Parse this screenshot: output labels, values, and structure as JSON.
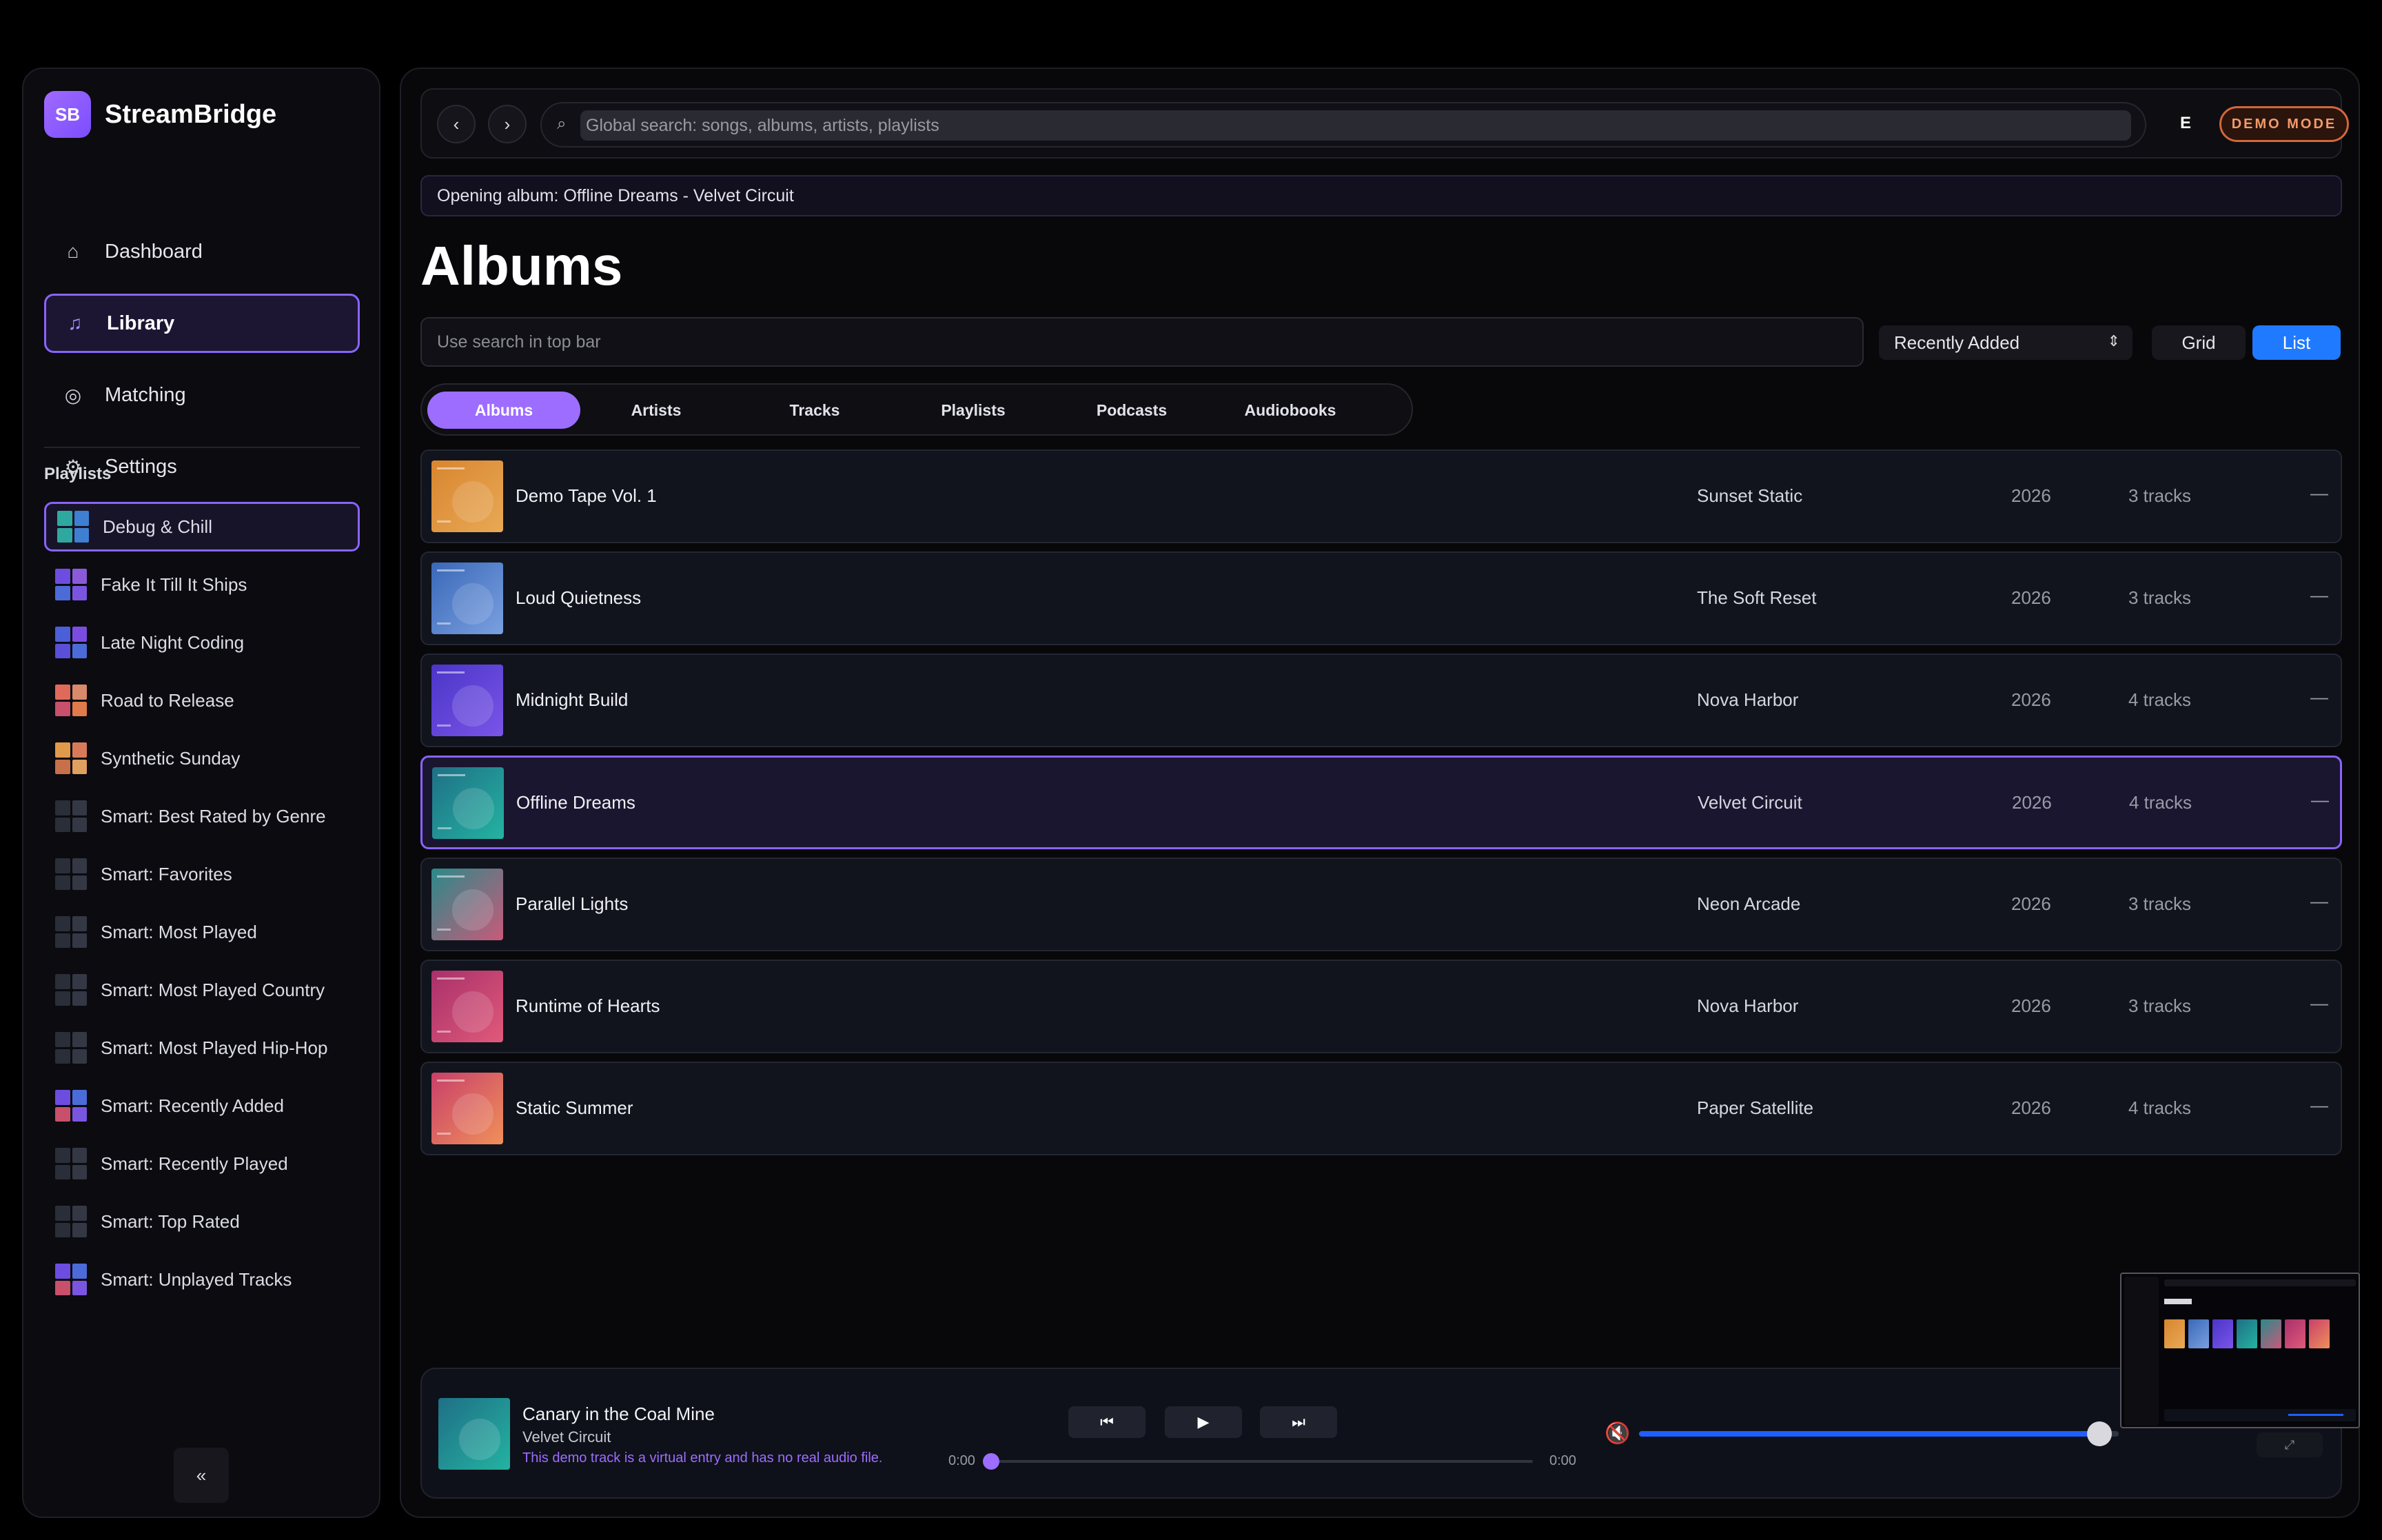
{
  "app": {
    "logo_text": "SB",
    "name": "StreamBridge"
  },
  "nav": {
    "items": [
      {
        "label": "Dashboard",
        "icon": "home-icon",
        "glyph": "⌂",
        "active": false
      },
      {
        "label": "Library",
        "icon": "music-note-icon",
        "glyph": "♫",
        "active": true
      },
      {
        "label": "Matching",
        "icon": "target-icon",
        "glyph": "◎",
        "active": false
      },
      {
        "label": "Settings",
        "icon": "gear-icon",
        "glyph": "⚙",
        "active": false
      }
    ]
  },
  "playlists": {
    "heading": "Playlists",
    "items": [
      {
        "label": "Debug & Chill",
        "active": true,
        "colors": [
          "#2fa9a0",
          "#3e7fd1",
          "#2fa9a0",
          "#3e7fd1"
        ]
      },
      {
        "label": "Fake It Till It Ships",
        "active": false,
        "colors": [
          "#6d4de0",
          "#8a5ad8",
          "#4b6bd8",
          "#7a55e0"
        ]
      },
      {
        "label": "Late Night Coding",
        "active": false,
        "colors": [
          "#4b5fd8",
          "#7a4de0",
          "#5a4fd8",
          "#4b6bd8"
        ]
      },
      {
        "label": "Road to Release",
        "active": false,
        "colors": [
          "#e06a5a",
          "#d88a6a",
          "#c8506a",
          "#e07a4a"
        ]
      },
      {
        "label": "Synthetic Sunday",
        "active": false,
        "colors": [
          "#e09a4a",
          "#d87a5a",
          "#c8704a",
          "#e0a060"
        ]
      },
      {
        "label": "Smart: Best Rated by Genre",
        "active": false,
        "colors": [
          "#2a2e38",
          "#343844",
          "#2a2e38",
          "#343844"
        ]
      },
      {
        "label": "Smart: Favorites",
        "active": false,
        "colors": [
          "#2a2e38",
          "#343844",
          "#2a2e38",
          "#343844"
        ]
      },
      {
        "label": "Smart: Most Played",
        "active": false,
        "colors": [
          "#2a2e38",
          "#343844",
          "#2a2e38",
          "#343844"
        ]
      },
      {
        "label": "Smart: Most Played Country",
        "active": false,
        "colors": [
          "#2a2e38",
          "#343844",
          "#2a2e38",
          "#343844"
        ]
      },
      {
        "label": "Smart: Most Played Hip-Hop",
        "active": false,
        "colors": [
          "#2a2e38",
          "#343844",
          "#2a2e38",
          "#343844"
        ]
      },
      {
        "label": "Smart: Recently Added",
        "active": false,
        "colors": [
          "#6d4de0",
          "#4b6bd8",
          "#c8506a",
          "#7a55e0"
        ]
      },
      {
        "label": "Smart: Recently Played",
        "active": false,
        "colors": [
          "#2a2e38",
          "#343844",
          "#2a2e38",
          "#343844"
        ]
      },
      {
        "label": "Smart: Top Rated",
        "active": false,
        "colors": [
          "#2a2e38",
          "#343844",
          "#2a2e38",
          "#343844"
        ]
      },
      {
        "label": "Smart: Unplayed Tracks",
        "active": false,
        "colors": [
          "#6d4de0",
          "#4b6bd8",
          "#c8506a",
          "#7a55e0"
        ]
      }
    ]
  },
  "sidebar": {
    "collapse_label": "«"
  },
  "topbar": {
    "back_label": "‹",
    "forward_label": "›",
    "search_icon": "⌕",
    "search_placeholder": "Global search: songs, albums, artists, playlists",
    "avatar_letter": "E",
    "demo_badge": "DEMO MODE"
  },
  "status": {
    "message": "Opening album: Offline Dreams - Velvet Circuit"
  },
  "page": {
    "title": "Albums",
    "filter_placeholder": "Use search in top bar",
    "sort_value": "Recently Added",
    "sort_chevron": "⌃⌄",
    "view_grid_label": "Grid",
    "view_list_label": "List"
  },
  "tabs": [
    {
      "label": "Albums",
      "active": true
    },
    {
      "label": "Artists",
      "active": false
    },
    {
      "label": "Tracks",
      "active": false
    },
    {
      "label": "Playlists",
      "active": false
    },
    {
      "label": "Podcasts",
      "active": false
    },
    {
      "label": "Audiobooks",
      "active": false
    }
  ],
  "albums": [
    {
      "title": "Demo Tape Vol. 1",
      "artist": "Sunset Static",
      "year": "2026",
      "tracks": "3 tracks",
      "more": "—",
      "active": false,
      "gradient": [
        "#d9852f",
        "#e8a955"
      ]
    },
    {
      "title": "Loud Quietness",
      "artist": "The Soft Reset",
      "year": "2026",
      "tracks": "3 tracks",
      "more": "—",
      "active": false,
      "gradient": [
        "#3a68b8",
        "#7aa0e0"
      ]
    },
    {
      "title": "Midnight Build",
      "artist": "Nova Harbor",
      "year": "2026",
      "tracks": "4 tracks",
      "more": "—",
      "active": false,
      "gradient": [
        "#4a35c8",
        "#7a55e8"
      ]
    },
    {
      "title": "Offline Dreams",
      "artist": "Velvet Circuit",
      "year": "2026",
      "tracks": "4 tracks",
      "more": "—",
      "active": true,
      "gradient": [
        "#1f6f86",
        "#24b3a1"
      ]
    },
    {
      "title": "Parallel Lights",
      "artist": "Neon Arcade",
      "year": "2026",
      "tracks": "3 tracks",
      "more": "—",
      "active": false,
      "gradient": [
        "#2a8a8a",
        "#c85a7a"
      ]
    },
    {
      "title": "Runtime of Hearts",
      "artist": "Nova Harbor",
      "year": "2026",
      "tracks": "3 tracks",
      "more": "—",
      "active": false,
      "gradient": [
        "#a8306a",
        "#e05a7a"
      ]
    },
    {
      "title": "Static Summer",
      "artist": "Paper Satellite",
      "year": "2026",
      "tracks": "4 tracks",
      "more": "—",
      "active": false,
      "gradient": [
        "#c8406a",
        "#f0905a"
      ]
    }
  ],
  "player": {
    "title": "Canary in the Coal Mine",
    "artist": "Velvet Circuit",
    "note": "This demo track is a virtual entry and has no real audio file.",
    "prev_label": "⏮",
    "play_label": "▶",
    "next_label": "⏭",
    "time_elapsed": "0:00",
    "time_total": "0:00",
    "progress": 0,
    "volume": 0.96,
    "mute_icon": "🔇",
    "expand_label": "⤢"
  },
  "colors": {
    "accent": "#9d6dff",
    "accent_border": "#8a63ff",
    "primary_blue": "#1f7aff",
    "demo_orange": "#d2673a"
  }
}
